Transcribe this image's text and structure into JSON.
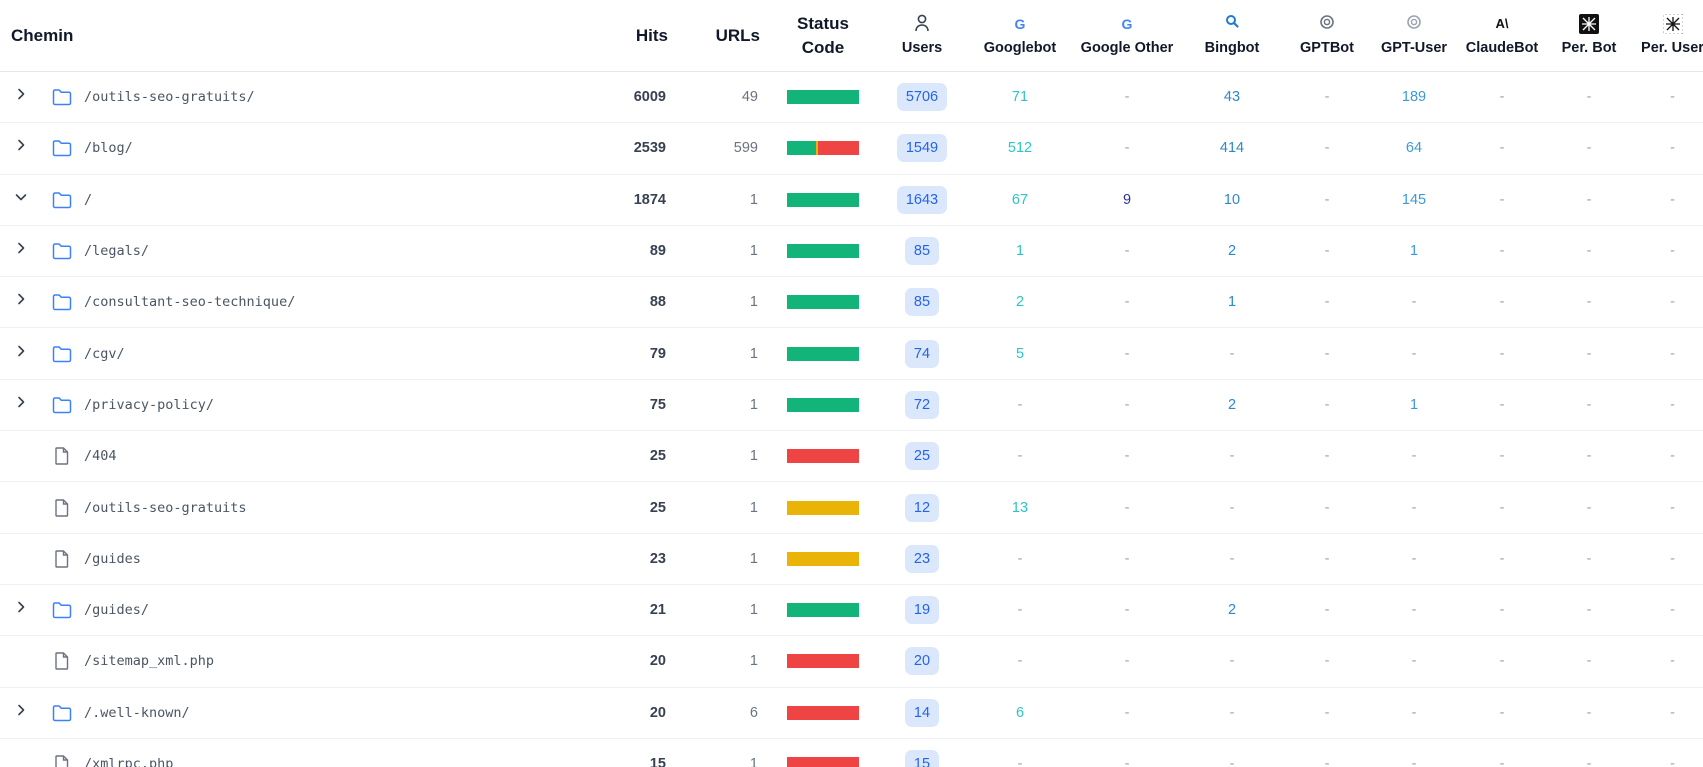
{
  "columns": {
    "path": "Chemin",
    "hits": "Hits",
    "urls": "URLs",
    "status": "Status Code",
    "users": "Users",
    "googlebot": "Googlebot",
    "google_other": "Google Other",
    "bingbot": "Bingbot",
    "gptbot": "GPTBot",
    "gpt_user": "GPT-User",
    "claudebot": "ClaudeBot",
    "per_bot": "Per. Bot",
    "per_user": "Per. User"
  },
  "icons": {
    "users": "user-icon",
    "googlebot": "google-icon",
    "google_other": "google-icon",
    "bingbot": "search-icon",
    "gptbot": "openai-icon",
    "gpt_user": "openai-icon",
    "claudebot": "anthropic-icon",
    "per_bot": "perplexity-icon",
    "per_user": "perplexity-icon"
  },
  "colors": {
    "status_ok": "#12b47a",
    "status_redirect": "#eab308",
    "status_error": "#ef4444",
    "googlebot": "#2bc5c5",
    "google_other": "#2f2f9e",
    "bingbot": "#2b8ac9",
    "gpt_user": "#3b9ad9",
    "users_pill_bg": "#dbe8fb",
    "users_pill_fg": "#2563eb"
  },
  "rows": [
    {
      "type": "folder",
      "expanded": false,
      "path": "/outils-seo-gratuits/",
      "hits": "6009",
      "urls": "49",
      "status": [
        {
          "c": "status_ok",
          "f": 1
        }
      ],
      "users": "5706",
      "googlebot": "71",
      "google_other": "-",
      "bingbot": "43",
      "gptbot": "-",
      "gpt_user": "189",
      "claudebot": "-",
      "per_bot": "-",
      "per_user": "-"
    },
    {
      "type": "folder",
      "expanded": false,
      "path": "/blog/",
      "hits": "2539",
      "urls": "599",
      "status": [
        {
          "c": "status_ok",
          "f": 0.4
        },
        {
          "c": "status_redirect",
          "f": 0.03
        },
        {
          "c": "status_error",
          "f": 0.57
        }
      ],
      "users": "1549",
      "googlebot": "512",
      "google_other": "-",
      "bingbot": "414",
      "gptbot": "-",
      "gpt_user": "64",
      "claudebot": "-",
      "per_bot": "-",
      "per_user": "-"
    },
    {
      "type": "folder",
      "expanded": true,
      "path": "/",
      "hits": "1874",
      "urls": "1",
      "status": [
        {
          "c": "status_ok",
          "f": 1
        }
      ],
      "users": "1643",
      "googlebot": "67",
      "google_other": "9",
      "bingbot": "10",
      "gptbot": "-",
      "gpt_user": "145",
      "claudebot": "-",
      "per_bot": "-",
      "per_user": "-"
    },
    {
      "type": "folder",
      "expanded": false,
      "path": "/legals/",
      "hits": "89",
      "urls": "1",
      "status": [
        {
          "c": "status_ok",
          "f": 1
        }
      ],
      "users": "85",
      "googlebot": "1",
      "google_other": "-",
      "bingbot": "2",
      "gptbot": "-",
      "gpt_user": "1",
      "claudebot": "-",
      "per_bot": "-",
      "per_user": "-"
    },
    {
      "type": "folder",
      "expanded": false,
      "path": "/consultant-seo-technique/",
      "hits": "88",
      "urls": "1",
      "status": [
        {
          "c": "status_ok",
          "f": 1
        }
      ],
      "users": "85",
      "googlebot": "2",
      "google_other": "-",
      "bingbot": "1",
      "gptbot": "-",
      "gpt_user": "-",
      "claudebot": "-",
      "per_bot": "-",
      "per_user": "-"
    },
    {
      "type": "folder",
      "expanded": false,
      "path": "/cgv/",
      "hits": "79",
      "urls": "1",
      "status": [
        {
          "c": "status_ok",
          "f": 1
        }
      ],
      "users": "74",
      "googlebot": "5",
      "google_other": "-",
      "bingbot": "-",
      "gptbot": "-",
      "gpt_user": "-",
      "claudebot": "-",
      "per_bot": "-",
      "per_user": "-"
    },
    {
      "type": "folder",
      "expanded": false,
      "path": "/privacy-policy/",
      "hits": "75",
      "urls": "1",
      "status": [
        {
          "c": "status_ok",
          "f": 1
        }
      ],
      "users": "72",
      "googlebot": "-",
      "google_other": "-",
      "bingbot": "2",
      "gptbot": "-",
      "gpt_user": "1",
      "claudebot": "-",
      "per_bot": "-",
      "per_user": "-"
    },
    {
      "type": "file",
      "expanded": false,
      "path": "/404",
      "hits": "25",
      "urls": "1",
      "status": [
        {
          "c": "status_error",
          "f": 1
        }
      ],
      "users": "25",
      "googlebot": "-",
      "google_other": "-",
      "bingbot": "-",
      "gptbot": "-",
      "gpt_user": "-",
      "claudebot": "-",
      "per_bot": "-",
      "per_user": "-"
    },
    {
      "type": "file",
      "expanded": false,
      "path": "/outils-seo-gratuits",
      "hits": "25",
      "urls": "1",
      "status": [
        {
          "c": "status_redirect",
          "f": 1
        }
      ],
      "users": "12",
      "googlebot": "13",
      "google_other": "-",
      "bingbot": "-",
      "gptbot": "-",
      "gpt_user": "-",
      "claudebot": "-",
      "per_bot": "-",
      "per_user": "-"
    },
    {
      "type": "file",
      "expanded": false,
      "path": "/guides",
      "hits": "23",
      "urls": "1",
      "status": [
        {
          "c": "status_redirect",
          "f": 1
        }
      ],
      "users": "23",
      "googlebot": "-",
      "google_other": "-",
      "bingbot": "-",
      "gptbot": "-",
      "gpt_user": "-",
      "claudebot": "-",
      "per_bot": "-",
      "per_user": "-"
    },
    {
      "type": "folder",
      "expanded": false,
      "path": "/guides/",
      "hits": "21",
      "urls": "1",
      "status": [
        {
          "c": "status_ok",
          "f": 1
        }
      ],
      "users": "19",
      "googlebot": "-",
      "google_other": "-",
      "bingbot": "2",
      "gptbot": "-",
      "gpt_user": "-",
      "claudebot": "-",
      "per_bot": "-",
      "per_user": "-"
    },
    {
      "type": "file",
      "expanded": false,
      "path": "/sitemap_xml.php",
      "hits": "20",
      "urls": "1",
      "status": [
        {
          "c": "status_error",
          "f": 1
        }
      ],
      "users": "20",
      "googlebot": "-",
      "google_other": "-",
      "bingbot": "-",
      "gptbot": "-",
      "gpt_user": "-",
      "claudebot": "-",
      "per_bot": "-",
      "per_user": "-"
    },
    {
      "type": "folder",
      "expanded": false,
      "path": "/.well-known/",
      "hits": "20",
      "urls": "6",
      "status": [
        {
          "c": "status_error",
          "f": 1
        }
      ],
      "users": "14",
      "googlebot": "6",
      "google_other": "-",
      "bingbot": "-",
      "gptbot": "-",
      "gpt_user": "-",
      "claudebot": "-",
      "per_bot": "-",
      "per_user": "-"
    },
    {
      "type": "file",
      "expanded": false,
      "path": "/xmlrpc.php",
      "hits": "15",
      "urls": "1",
      "status": [
        {
          "c": "status_error",
          "f": 1
        }
      ],
      "users": "15",
      "googlebot": "-",
      "google_other": "-",
      "bingbot": "-",
      "gptbot": "-",
      "gpt_user": "-",
      "claudebot": "-",
      "per_bot": "-",
      "per_user": "-"
    }
  ]
}
